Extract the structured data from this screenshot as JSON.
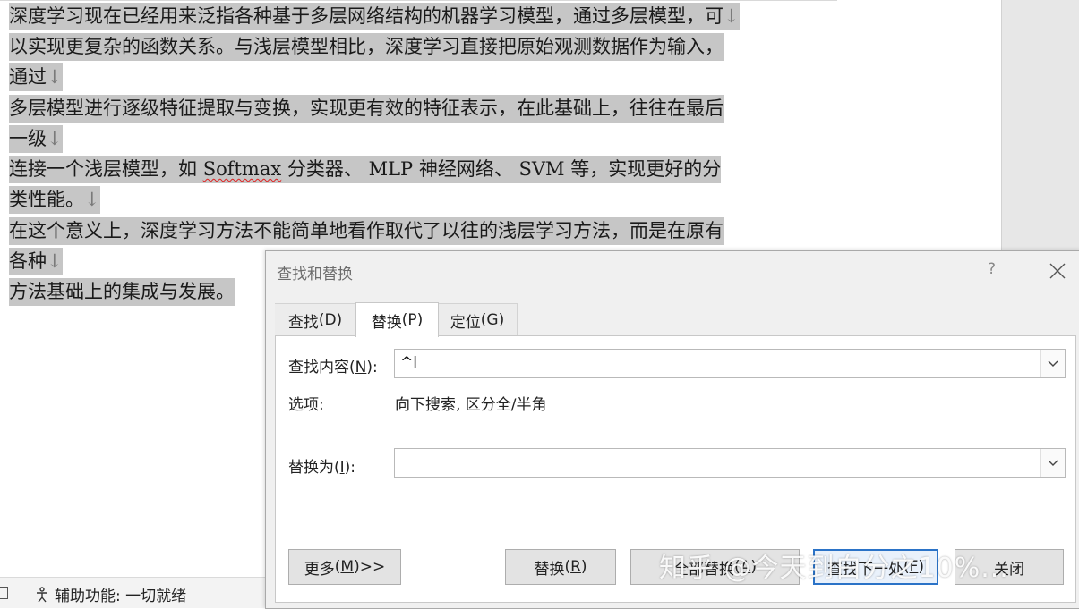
{
  "document": {
    "lines": [
      {
        "text": "深度学习现在已经用来泛指各种基于多层网络结构的机器学习模型，通过多层模型，可",
        "mark": "↓"
      },
      {
        "text": "以实现更复杂的函数关系。与浅层模型相比，深度学习直接把原始观测数据作为输入，",
        "mark": ""
      },
      {
        "text": "通过",
        "mark": "↓"
      },
      {
        "text": "多层模型进行逐级特征提取与变换，实现更有效的特征表示，在此基础上，往往在最后",
        "mark": ""
      },
      {
        "text": "一级",
        "mark": "↓"
      },
      {
        "pre": "连接一个浅层模型，如 ",
        "spell": "Softmax",
        "post": " 分类器、 MLP 神经网络、 SVM 等，实现更好的分",
        "mark": ""
      },
      {
        "text": "类性能。",
        "mark": "↓"
      },
      {
        "text": "在这个意义上，深度学习方法不能简单地看作取代了以往的浅层学习方法，而是在原有",
        "mark": ""
      },
      {
        "text": "各种",
        "mark": "↓"
      },
      {
        "text": "方法基础上的集成与发展。",
        "mark": ""
      }
    ]
  },
  "statusbar": {
    "accessibility": "辅助功能: 一切就绪"
  },
  "dialog": {
    "title": "查找和替换",
    "help": "?",
    "tabs": [
      {
        "label": "查找",
        "key": "D"
      },
      {
        "label": "替换",
        "key": "P"
      },
      {
        "label": "定位",
        "key": "G"
      }
    ],
    "active_tab": "替换",
    "find_label": {
      "label": "查找内容",
      "key": "N"
    },
    "find_value": "^l",
    "options_label": "选项:",
    "options_value": "向下搜索, 区分全/半角",
    "replace_label": {
      "label": "替换为",
      "key": "I"
    },
    "replace_value": "",
    "buttons": {
      "more": {
        "label": "更多",
        "key": "M",
        "suffix": " >>"
      },
      "replace": {
        "label": "替换",
        "key": "R"
      },
      "replace_all": {
        "label": "全部替换",
        "key": "A"
      },
      "find_next": {
        "label": "查找下一处",
        "key": "F"
      },
      "close": {
        "label": "关闭"
      }
    }
  },
  "watermark": "知乎 @今天到白分之10%...",
  "colors": {
    "selection": "#c6c6c6",
    "default_button_border": "#2b73c7",
    "dialog_bg": "#f0f0f0"
  }
}
